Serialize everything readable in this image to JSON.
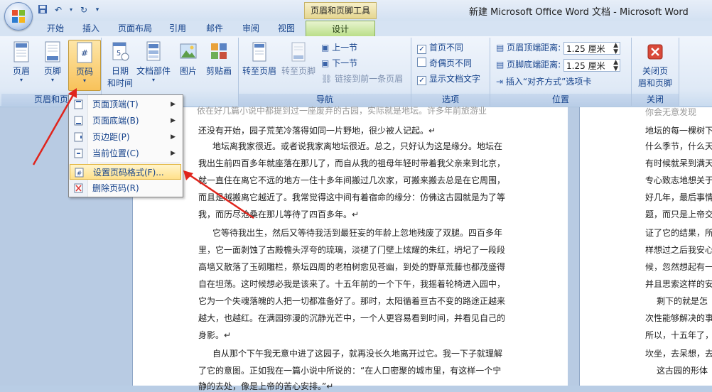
{
  "window": {
    "title": "新建 Microsoft Office Word 文档 - Microsoft Word",
    "context_tab_group": "页眉和页脚工具"
  },
  "quick_access": {
    "icons": [
      "save-icon",
      "undo-icon",
      "redo-icon",
      "customize-icon"
    ]
  },
  "tabs": [
    {
      "label": "开始"
    },
    {
      "label": "插入"
    },
    {
      "label": "页面布局"
    },
    {
      "label": "引用"
    },
    {
      "label": "邮件"
    },
    {
      "label": "审阅"
    },
    {
      "label": "视图"
    },
    {
      "label": "设计"
    }
  ],
  "ribbon": {
    "header_footer": {
      "group_label": "页眉和页",
      "header_btn": "页眉",
      "footer_btn": "页脚",
      "page_number_btn": "页码"
    },
    "insert": {
      "date_time_1": "日期",
      "date_time_2": "和时间",
      "doc_parts": "文档部件",
      "picture": "图片",
      "clipart": "剪贴画"
    },
    "navigation": {
      "group_label": "导航",
      "goto_header": "转至页眉",
      "goto_footer": "转至页脚",
      "prev_section": "上一节",
      "next_section": "下一节",
      "link_previous": "链接到前一条页眉"
    },
    "options": {
      "group_label": "选项",
      "diff_first": "首页不同",
      "diff_odd_even": "奇偶页不同",
      "show_text": "显示文档文字",
      "diff_first_checked": "✓",
      "show_text_checked": "✓"
    },
    "position": {
      "group_label": "位置",
      "header_top_label": "页眉顶端距离:",
      "header_top_value": "1.25 厘米",
      "footer_bottom_label": "页脚底端距离:",
      "footer_bottom_value": "1.25 厘米",
      "insert_align_tab": "插入“对齐方式”选项卡"
    },
    "close": {
      "group_label": "关闭",
      "close_line1": "关闭页",
      "close_line2": "眉和页脚"
    }
  },
  "page_number_menu": {
    "items": [
      {
        "label": "页面顶端(T)",
        "icon": "page-top-icon",
        "submenu": "▶"
      },
      {
        "label": "页面底端(B)",
        "icon": "page-bottom-icon",
        "submenu": "▶"
      },
      {
        "label": "页边距(P)",
        "icon": "page-margin-icon",
        "submenu": "▶"
      },
      {
        "label": "当前位置(C)",
        "icon": "current-position-icon",
        "submenu": "▶"
      },
      {
        "label": "设置页码格式(F)...",
        "icon": "format-page-number-icon",
        "highlighted": true
      },
      {
        "label": "删除页码(R)",
        "icon": "remove-page-number-icon"
      }
    ]
  },
  "document": {
    "lines": [
      "还没有开始，园子荒芜冷落得如同一片野地，很少被人记起。↵",
      "地坛离我家很近。或者说我家离地坛很近。总之，只好认为这是缘分。地坛在",
      "我出生前四百多年就座落在那儿了，而自从我的祖母年轻时带着我父亲来到北京，",
      "就一直住在离它不远的地方一住十多年间搬过几次家，可搬来搬去总是在它周围，",
      "而且是越搬离它越近了。我常觉得这中间有着宿命的缘分：仿佛这古园就是为了等",
      "我，而历尽沧桑在那儿等待了四百多年。↵",
      "它等待我出生，然后又等待我活到最狂妄的年龄上忽地残废了双腿。四百多年",
      "里，它一面剥蚀了古殿檐头浮夸的琉璃，淡褪了门壁上炫耀的朱红，坍圮了一段段",
      "高墙又散落了玉砌雕栏，祭坛四周的老柏树愈见苍幽，到处的野草荒藤也都茂盛得",
      "自在坦荡。这时候想必我是该来了。十五年前的一个下午，我摇着轮椅进入园中，",
      "它为一个失魂落魄的人把一切都准备好了。那时，太阳循着亘古不变的路途正越来",
      "越大，也越红。在满园弥漫的沉静光芒中，一个人更容易看到时间，并看见自己的",
      "身影。↵",
      "自从那个下午我无意中进了这园子，就再没长久地离开过它。我一下子就理解",
      "了它的意图。正如我在一篇小说中所说的：“在人口密聚的城市里，有这样一个宁",
      "静的去处，像是上帝的苦心安排。”↵"
    ],
    "top_partial": "依在好几篇小说中都提到过一座废弃的古园，实际就是地坛。许多年前旅游业",
    "right_page_lines": [
      "你会无意发现",
      "地坛的每一棵树下",
      "什么季节，什么天",
      "有时候就呆到满天",
      "专心致志地想关于",
      "好几年，最后事情",
      "题，而只是上帝交",
      "证了它的结果，所",
      "样想过之后我安心",
      "候，忽然想起有一",
      "并且思索这样的安",
      "剩下的就是怎",
      "次性能够解决的事",
      "所以，十五年了，",
      "坎坐，去呆想，去",
      "这古园的形体"
    ]
  },
  "colors": {
    "accent_orange": "#f8c25a",
    "annotation_red": "#e0241c",
    "ribbon_text": "#15428b"
  }
}
